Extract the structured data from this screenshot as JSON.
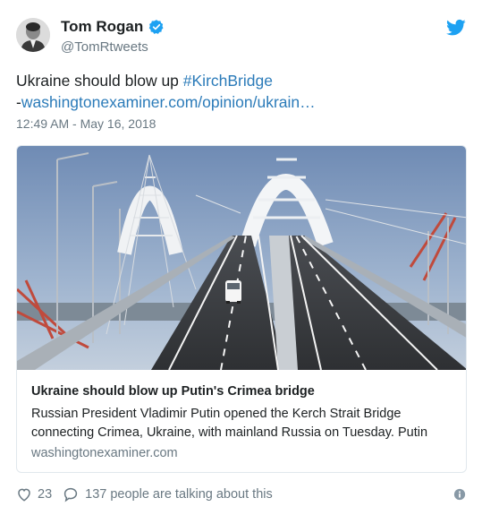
{
  "author": {
    "name": "Tom Rogan",
    "handle": "@TomRtweets"
  },
  "tweet": {
    "text_prefix": "Ukraine should blow up ",
    "hashtag": "#KirchBridge",
    "link_prefix": "-",
    "link": "washingtonexaminer.com/opinion/ukrain…",
    "timestamp": "12:49 AM - May 16, 2018"
  },
  "card": {
    "title": "Ukraine should blow up Putin's Crimea bridge",
    "description": "Russian President Vladimir Putin opened the Kerch Strait Bridge connecting Crimea, Ukraine, with mainland Russia on Tuesday. Putin",
    "domain": "washingtonexaminer.com"
  },
  "footer": {
    "likes": "23",
    "talking": "137 people are talking about this"
  },
  "colors": {
    "link": "#2b7bb9",
    "twitter_blue": "#1da1f2",
    "muted": "#697882",
    "text": "#1c2022"
  },
  "icons": [
    "verified-badge-icon",
    "twitter-bird-icon",
    "heart-icon",
    "reply-bubble-icon",
    "info-icon"
  ]
}
